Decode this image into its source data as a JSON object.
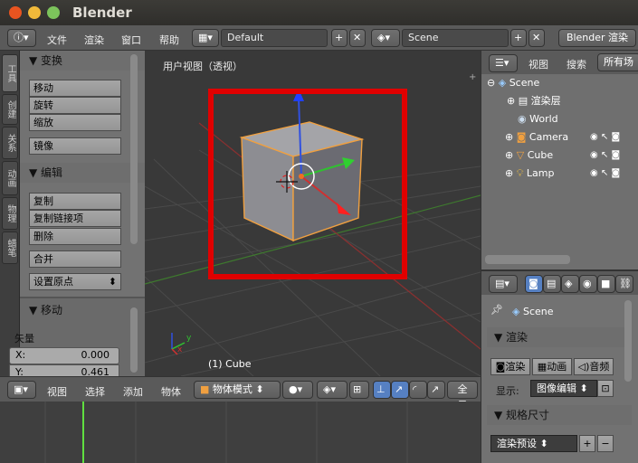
{
  "window": {
    "title": "Blender"
  },
  "info_header": {
    "menus": [
      "文件",
      "渲染",
      "窗口",
      "帮助"
    ],
    "screen_layout": "Default",
    "scene": "Scene",
    "render_engine": "Blender 渲染"
  },
  "tool_tabs": [
    "工具",
    "创建",
    "关系",
    "动画",
    "物理",
    "蜡笔"
  ],
  "tool_shelf": {
    "transform_header": "变换",
    "transform_buttons": [
      "移动",
      "旋转",
      "缩放",
      "镜像"
    ],
    "edit_header": "编辑",
    "edit_buttons": [
      "复制",
      "复制链接项",
      "删除",
      "合并"
    ],
    "origin_dropdown": "设置原点",
    "operator_header": "移动",
    "vector_label": "矢量",
    "x_label": "X:",
    "x_value": "0.000",
    "y_label": "Y:",
    "y_value": "0.461"
  },
  "viewport": {
    "view_label": "用户视图（透视）",
    "object_label": "(1) Cube",
    "axis_x": "x",
    "axis_y": "y"
  },
  "viewport_header": {
    "menus": [
      "视图",
      "选择",
      "添加",
      "物体"
    ],
    "mode": "物体模式",
    "global": "全局"
  },
  "outliner_header": {
    "view": "视图",
    "search": "搜索",
    "all_scenes": "所有场"
  },
  "outliner": [
    {
      "name": "Scene",
      "icon": "scene-icon"
    },
    {
      "name": "渲染层",
      "icon": "render-layer-icon"
    },
    {
      "name": "World",
      "icon": "world-icon"
    },
    {
      "name": "Camera",
      "icon": "camera-icon"
    },
    {
      "name": "Cube",
      "icon": "mesh-icon"
    },
    {
      "name": "Lamp",
      "icon": "lamp-icon"
    }
  ],
  "properties": {
    "scene_label": "Scene",
    "render_header": "渲染",
    "render_buttons": [
      "渲染",
      "动画",
      "音频"
    ],
    "display_label": "显示:",
    "display_value": "图像编辑",
    "dimensions_header": "规格尺寸",
    "render_preset": "渲染预设"
  },
  "colors": {
    "highlight_box": "#e00000",
    "accent_blue": "#5680c2"
  }
}
